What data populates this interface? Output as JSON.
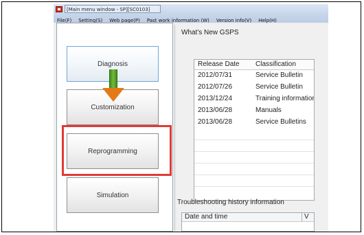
{
  "window": {
    "title": "[Main menu window - SP][SC0103]"
  },
  "menu": [
    {
      "label": "File(F)"
    },
    {
      "label": "Setting(S)"
    },
    {
      "label": "Web page(P)"
    },
    {
      "label": "Past work information (W)"
    },
    {
      "label": "Version info(V)"
    },
    {
      "label": "Help(H)"
    }
  ],
  "nav": {
    "diagnosis": "Diagnosis",
    "customization": "Customization",
    "reprogramming": "Reprogramming",
    "simulation": "Simulation"
  },
  "whats_new": {
    "title": "What's New GSPS",
    "columns": [
      "Release Date",
      "Classification"
    ],
    "rows": [
      [
        "2012/07/31",
        "Service Bulletin"
      ],
      [
        "2012/07/26",
        "Service Bulletin"
      ],
      [
        "2013/12/24",
        "Training information"
      ],
      [
        "2013/06/28",
        "Manuals"
      ],
      [
        "2013/06/28",
        "Service Bulletins"
      ]
    ]
  },
  "troubleshooting": {
    "title": "Troubleshooting history information",
    "columns": [
      "Date and time",
      "V"
    ]
  },
  "colors": {
    "highlight": "#e03a36",
    "arrow_shaft": "#77b83a",
    "arrow_head": "#e37a17"
  }
}
